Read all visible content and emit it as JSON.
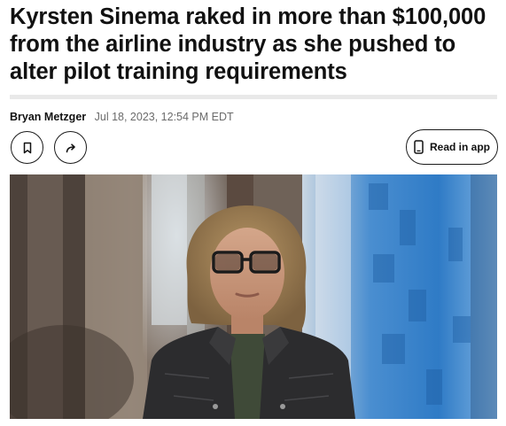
{
  "article": {
    "headline_lines": [
      "Kyrsten Sinema raked in more than $100,000",
      "from the airline industry as she pushed to",
      "alter pilot training requirements"
    ],
    "author": "Bryan Metzger",
    "timestamp": "Jul 18, 2023, 12:54 PM EDT"
  },
  "actions": {
    "read_in_app_label": "Read in app"
  },
  "icons": {
    "save": "bookmark-icon",
    "share": "share-arrow-icon",
    "app": "phone-icon"
  },
  "colors": {
    "text": "#111111",
    "meta": "#6b6b6b",
    "divider": "#e9e9e9",
    "button_border": "#1a1a1a"
  }
}
